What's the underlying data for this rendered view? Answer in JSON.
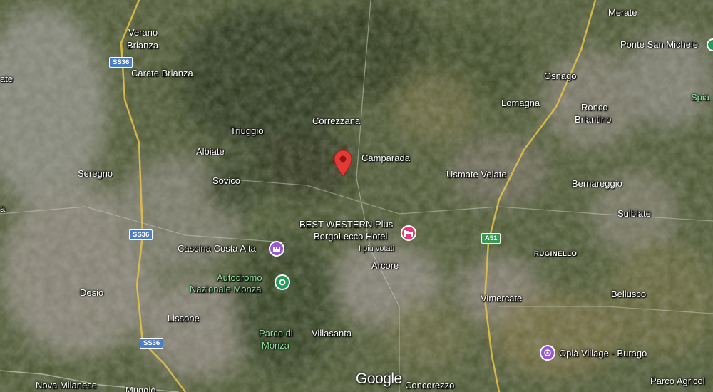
{
  "map": {
    "type": "satellite",
    "provider": "Google"
  },
  "places": [
    {
      "id": "verano",
      "text": "Verano"
    },
    {
      "id": "brianza",
      "text": "Brianza"
    },
    {
      "id": "carate",
      "text": "Carate Brianza"
    },
    {
      "id": "triuggio",
      "text": "Triuggio"
    },
    {
      "id": "correzzana",
      "text": "Correzzana"
    },
    {
      "id": "camparada",
      "text": "Camparada"
    },
    {
      "id": "albiate",
      "text": "Albiate"
    },
    {
      "id": "seregno",
      "text": "Seregno"
    },
    {
      "id": "sovico",
      "text": "Sovico"
    },
    {
      "id": "usmate",
      "text": "Usmate Velate"
    },
    {
      "id": "lomagna",
      "text": "Lomagna"
    },
    {
      "id": "osnago",
      "text": "Osnago"
    },
    {
      "id": "merate",
      "text": "Merate"
    },
    {
      "id": "ponte",
      "text": "Ponte San Michele"
    },
    {
      "id": "ronco",
      "text": "Ronco"
    },
    {
      "id": "briantino",
      "text": "Briantino"
    },
    {
      "id": "bernareggio",
      "text": "Bernareggio"
    },
    {
      "id": "sulbiate",
      "text": "Sulbiate"
    },
    {
      "id": "arcore",
      "text": "Arcore"
    },
    {
      "id": "desio",
      "text": "Desio"
    },
    {
      "id": "lissone",
      "text": "Lissone"
    },
    {
      "id": "villasanta",
      "text": "Villasanta"
    },
    {
      "id": "vimercate",
      "text": "Vimercate"
    },
    {
      "id": "bellusco",
      "text": "Bellusco"
    },
    {
      "id": "nova",
      "text": "Nova Milanese"
    },
    {
      "id": "muggio",
      "text": "Muggiò"
    },
    {
      "id": "concorezzo",
      "text": "Concorezzo"
    },
    {
      "id": "ate",
      "text": "ate"
    },
    {
      "id": "a_left",
      "text": "a"
    },
    {
      "id": "spia",
      "text": "Spia"
    }
  ],
  "green_labels": [
    {
      "id": "autodromo1",
      "text": "Autodromo"
    },
    {
      "id": "autodromo2",
      "text": "Nazionale Monza"
    },
    {
      "id": "parco1",
      "text": "Parco di"
    },
    {
      "id": "parco2",
      "text": "Monza"
    }
  ],
  "small_labels": [
    {
      "id": "ruginello",
      "text": "RUGINELLO"
    }
  ],
  "pois": {
    "hotel_name1": "BEST WESTERN Plus",
    "hotel_name2": "BorgoLecco Hotel",
    "hotel_note": "I più votati",
    "cascina": "Cascina Costa Alta",
    "opla": "Oplà Village - Burago",
    "parco_agricolo": "Parco Agricol"
  },
  "shields": [
    {
      "id": "ss36a",
      "text": "SS36"
    },
    {
      "id": "ss36b",
      "text": "SS36"
    },
    {
      "id": "ss36c",
      "text": "SS36"
    },
    {
      "id": "a51",
      "text": "A51"
    }
  ],
  "logo": "Google",
  "colors": {
    "pin_red": "#e53935",
    "poi_hotel": "#e5387a",
    "poi_purple": "#9b59d0",
    "poi_park": "#1f9d5a",
    "road_major": "#e8c34a"
  },
  "icons": {
    "selected_pin": "map-pin-icon",
    "hotel": "bed-icon",
    "cascina": "castle-icon",
    "autodromo": "park-icon",
    "opla": "attraction-icon"
  }
}
